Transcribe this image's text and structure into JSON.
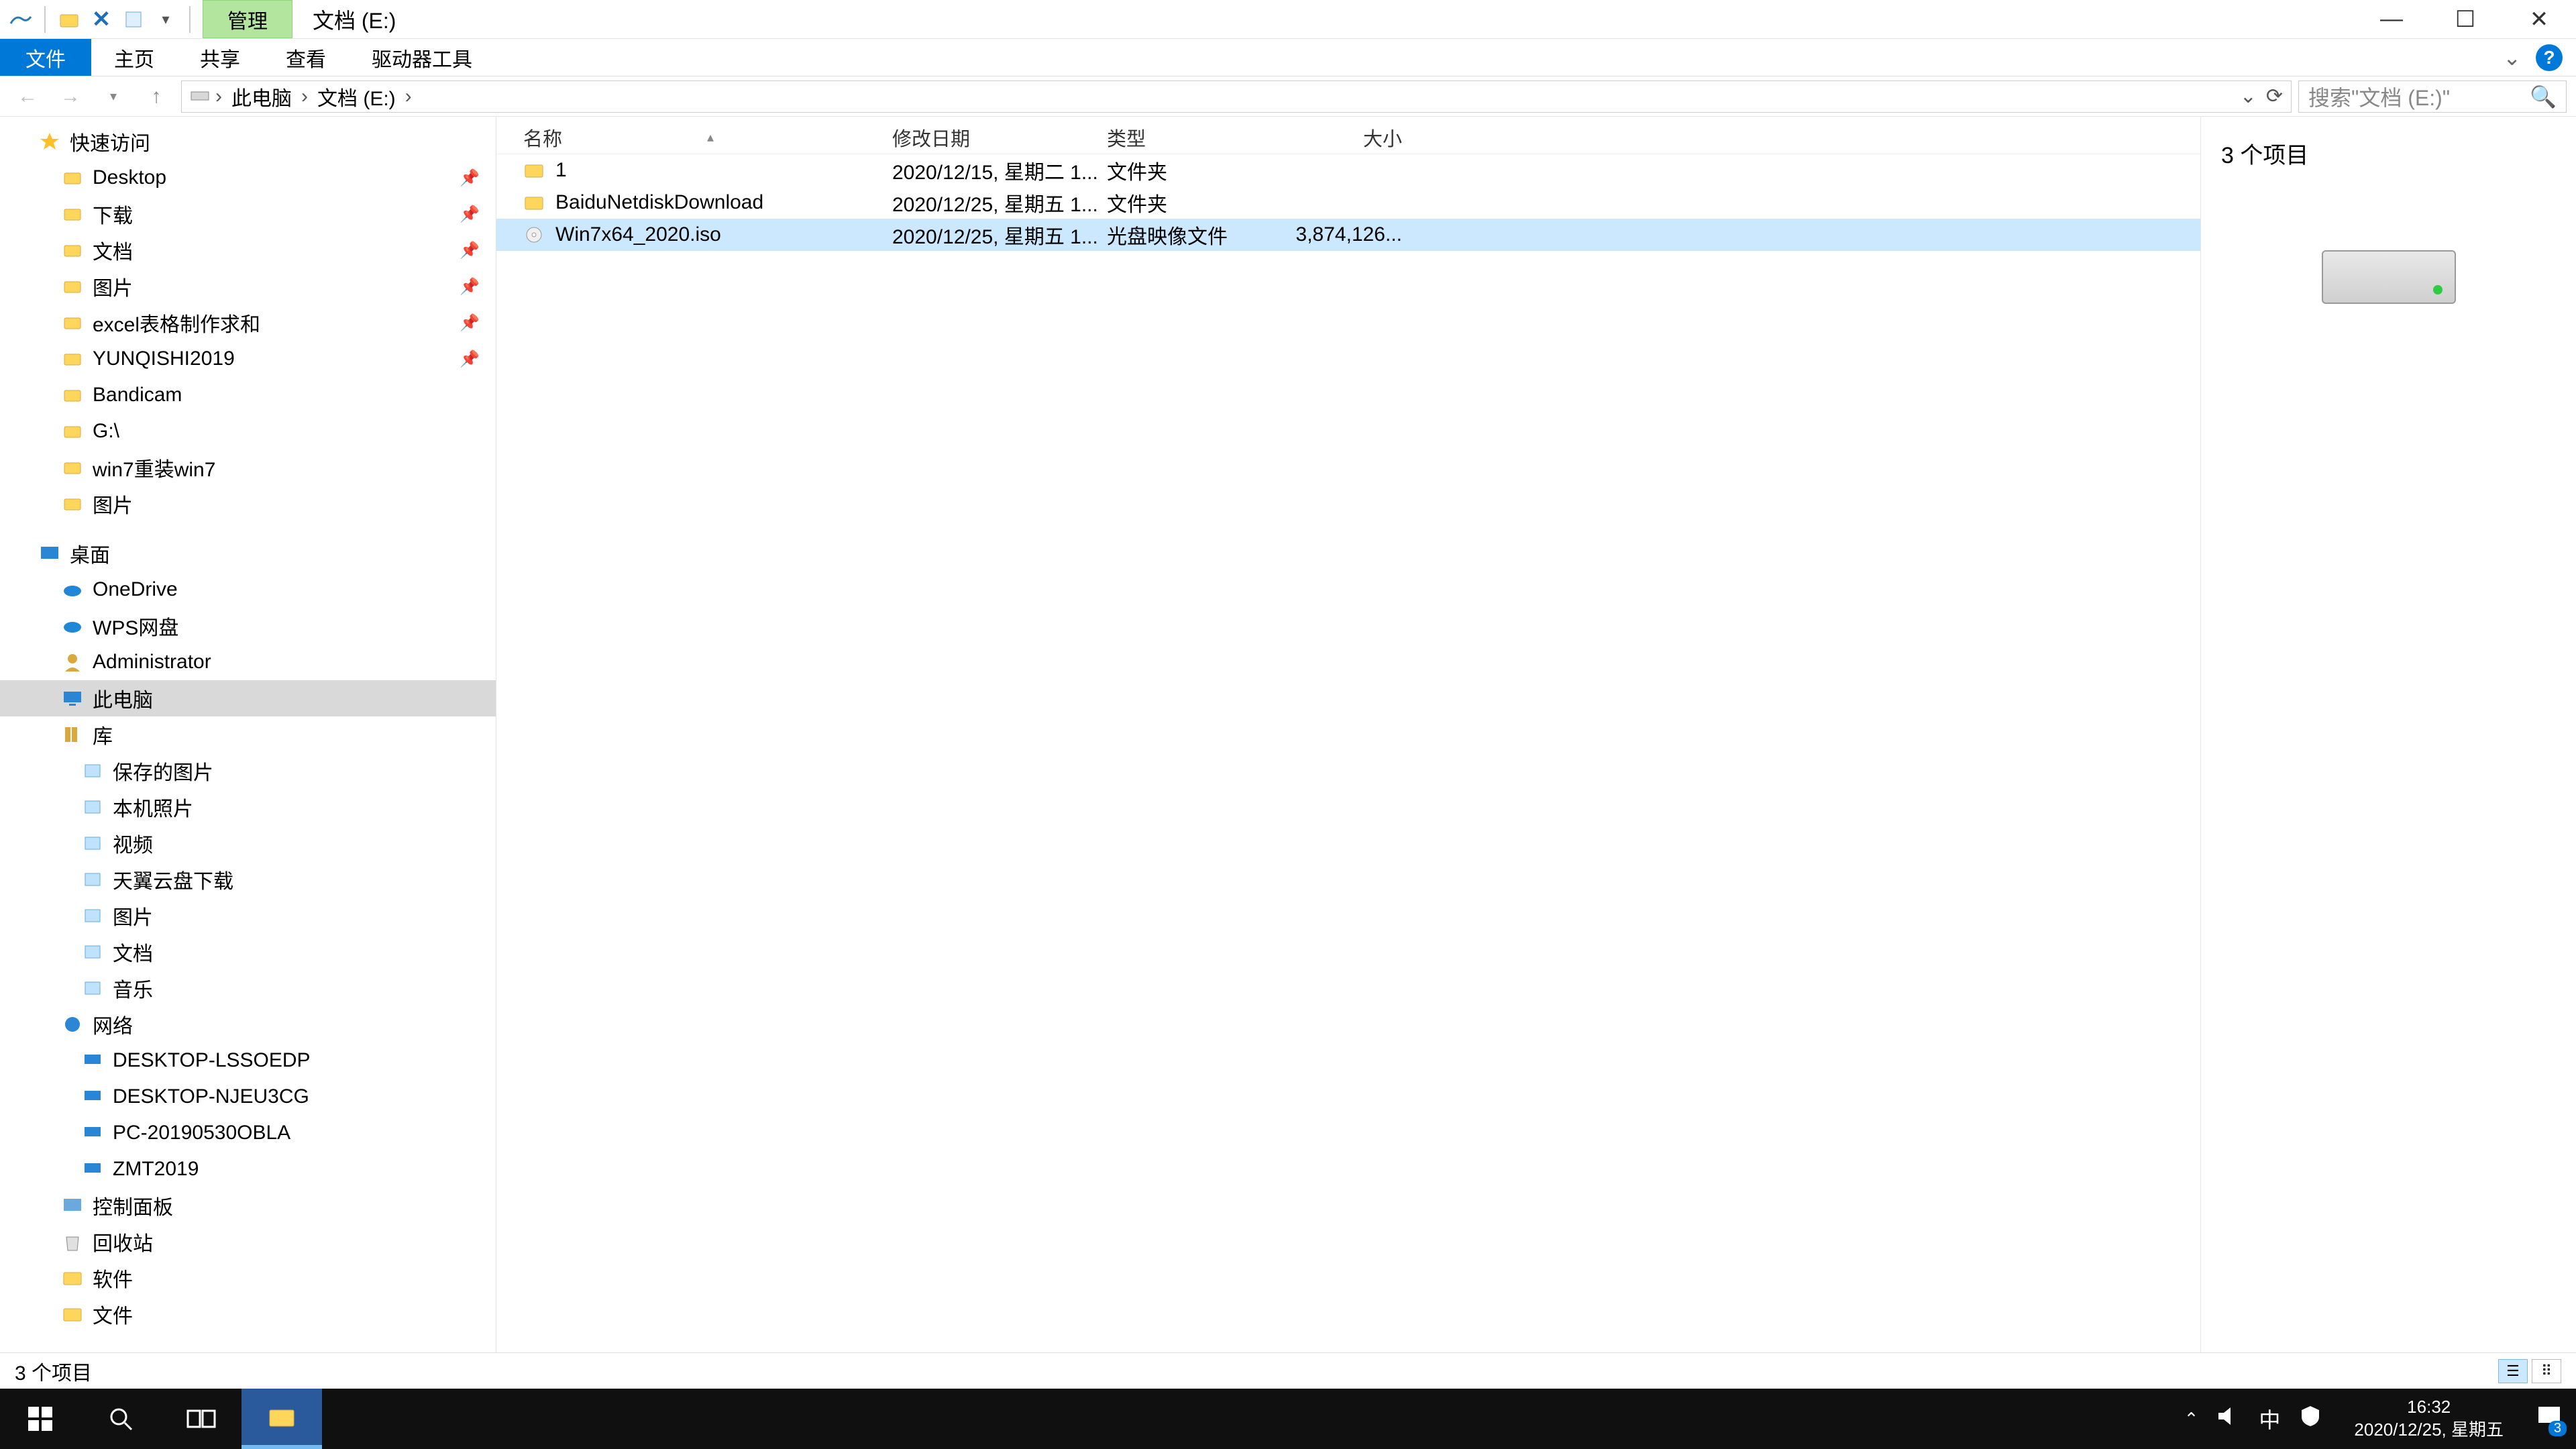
{
  "titlebar": {
    "tab_manage": "管理",
    "location": "文档 (E:)"
  },
  "ribbon": {
    "file": "文件",
    "home": "主页",
    "share": "共享",
    "view": "查看",
    "drive_tools": "驱动器工具"
  },
  "breadcrumb": {
    "this_pc": "此电脑",
    "drive": "文档 (E:)"
  },
  "search": {
    "placeholder": "搜索\"文档 (E:)\""
  },
  "sidebar": {
    "quick_access": "快速访问",
    "qa_items": [
      {
        "label": "Desktop",
        "pinned": true
      },
      {
        "label": "下载",
        "pinned": true
      },
      {
        "label": "文档",
        "pinned": true
      },
      {
        "label": "图片",
        "pinned": true
      },
      {
        "label": "excel表格制作求和",
        "pinned": true
      },
      {
        "label": "YUNQISHI2019",
        "pinned": true
      },
      {
        "label": "Bandicam",
        "pinned": false
      },
      {
        "label": "G:\\",
        "pinned": false
      },
      {
        "label": "win7重装win7",
        "pinned": false
      },
      {
        "label": "图片",
        "pinned": false
      }
    ],
    "desktop": "桌面",
    "desktop_items": [
      "OneDrive",
      "WPS网盘",
      "Administrator",
      "此电脑",
      "库"
    ],
    "lib_items": [
      "保存的图片",
      "本机照片",
      "视频",
      "天翼云盘下载",
      "图片",
      "文档",
      "音乐"
    ],
    "network": "网络",
    "network_items": [
      "DESKTOP-LSSOEDP",
      "DESKTOP-NJEU3CG",
      "PC-20190530OBLA",
      "ZMT2019"
    ],
    "control_panel": "控制面板",
    "recycle": "回收站",
    "software": "软件",
    "files": "文件"
  },
  "columns": {
    "name": "名称",
    "date": "修改日期",
    "type": "类型",
    "size": "大小"
  },
  "rows": [
    {
      "name": "1",
      "date": "2020/12/15, 星期二 1...",
      "type": "文件夹",
      "size": "",
      "kind": "folder",
      "selected": false
    },
    {
      "name": "BaiduNetdiskDownload",
      "date": "2020/12/25, 星期五 1...",
      "type": "文件夹",
      "size": "",
      "kind": "folder",
      "selected": false
    },
    {
      "name": "Win7x64_2020.iso",
      "date": "2020/12/25, 星期五 1...",
      "type": "光盘映像文件",
      "size": "3,874,126...",
      "kind": "iso",
      "selected": true
    }
  ],
  "preview": {
    "count": "3 个项目"
  },
  "statusbar": {
    "text": "3 个项目"
  },
  "taskbar": {
    "time": "16:32",
    "date": "2020/12/25, 星期五",
    "ime": "中",
    "action_badge": "3"
  }
}
